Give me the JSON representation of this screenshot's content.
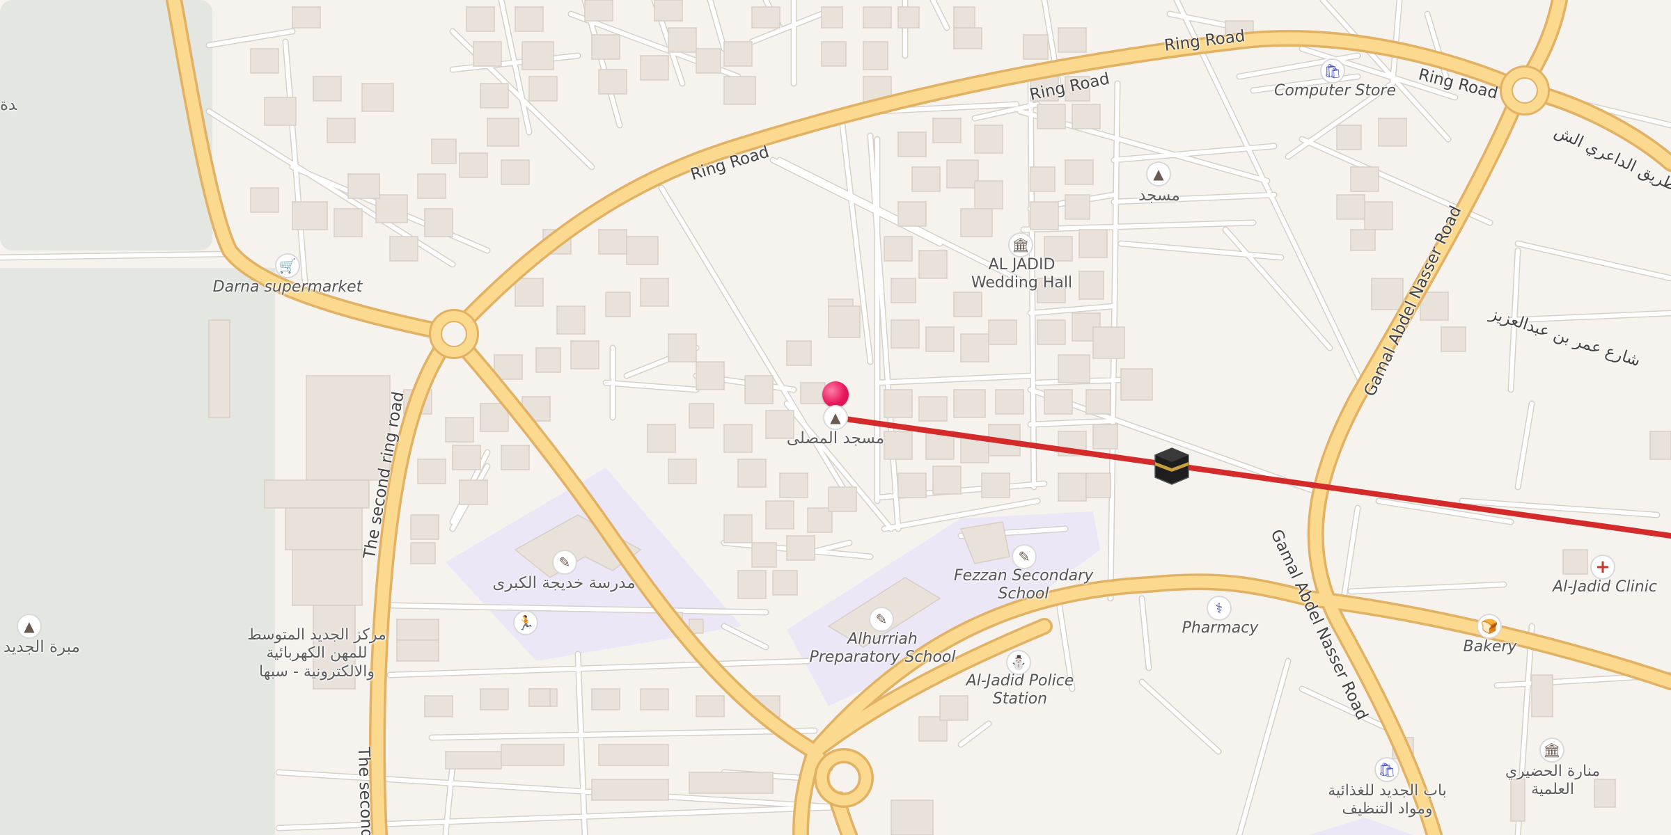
{
  "colors": {
    "background": "#f6f3ef",
    "major_road": "#fbd98e",
    "major_road_casing": "#e2b163",
    "minor_road": "#ffffff",
    "building": "#e9e2db",
    "school_area": "#ece7f7",
    "park_area": "#e3e6e1",
    "route_line": "#d42a2a",
    "pin": "#e8175d"
  },
  "route": {
    "description_icons": {
      "start": "map-pin-icon",
      "end": "kaaba-icon"
    }
  },
  "road_labels": {
    "ring_road_1": "Ring Road",
    "ring_road_2": "Ring Road",
    "ring_road_3": "Ring Road",
    "ring_road_4": "Ring Road",
    "second_ring_road_1": "The second ring road",
    "second_ring_road_2": "The second r",
    "gamal_1": "Gamal Abdel Nasser Road",
    "gamal_2": "Gamal Abdel Nasser Road",
    "arabic_road_1": "طريق الداعري الش",
    "arabic_road_2": "شارع عمر بن عبدالعزيز"
  },
  "places": {
    "computer_store": {
      "label": "Computer Store",
      "icon": "shopping-bag-icon"
    },
    "mosque_top": {
      "label": "مسجد",
      "icon": "mosque-icon"
    },
    "wedding_hall": {
      "label_1": "AL JADID",
      "label_2": "Wedding Hall",
      "icon": "museum-icon"
    },
    "darna": {
      "label": "Darna supermarket",
      "icon": "cart-icon"
    },
    "mosque_pin": {
      "label": "مسجد المصلى",
      "icon": "mosque-icon"
    },
    "khadija_school": {
      "label": "مدرسة خديجة الكبرى",
      "icon": "school-icon"
    },
    "sport": {
      "icon": "running-icon"
    },
    "fezzan_school": {
      "label_1": "Fezzan Secondary",
      "label_2": "School",
      "icon": "school-icon"
    },
    "alhurriah": {
      "label_1": "Alhurriah",
      "label_2": "Preparatory School",
      "icon": "school-icon"
    },
    "police": {
      "label_1": "Al-Jadid Police",
      "label_2": "Station",
      "icon": "police-icon"
    },
    "pharmacy": {
      "label": "Pharmacy",
      "icon": "pharmacy-icon"
    },
    "bakery": {
      "label": "Bakery",
      "icon": "bakery-icon"
    },
    "clinic": {
      "label": "Al-Jadid Clinic",
      "icon": "cross-icon"
    },
    "center": {
      "label_1": "مركز الجديد المتوسط",
      "label_2": "للمهن الكهربائية",
      "label_3": "والالكترونية - سبها"
    },
    "left_edge_1": {
      "label": "يدة"
    },
    "left_edge_2": {
      "label": "مبرة الجديد",
      "icon": "waste-icon"
    },
    "bab_store": {
      "label_1": "باب الجديد للغذائية",
      "label_2": "ومواد التنظيف",
      "icon": "shopping-bag-icon"
    },
    "hadiri": {
      "label_1": "منارة الحضيري",
      "label_2": "العلمية",
      "icon": "museum-icon"
    }
  }
}
